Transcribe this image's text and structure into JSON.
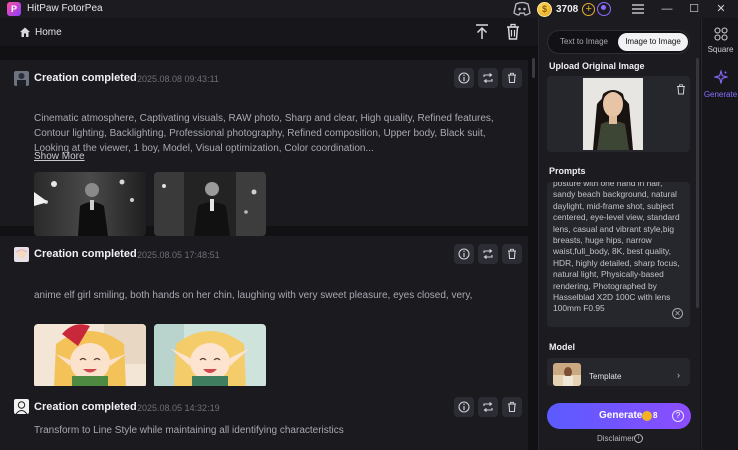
{
  "app": {
    "title": "HitPaw FotorPea",
    "logo_letter": "P"
  },
  "titlebar": {
    "coin_symbol": "$",
    "coins": "3708",
    "plus": "+"
  },
  "window": {
    "minimize": "—",
    "maximize": "☐",
    "close": "✕"
  },
  "header": {
    "home_label": "Home"
  },
  "cards": [
    {
      "title": "Creation completed",
      "date": "2025.08.08   09:43:11",
      "prompt": "Cinematic atmosphere, Captivating visuals, RAW photo, Sharp and clear, High quality, Refined features, Contour lighting, Backlighting, Professional photography, Refined composition, Upper body, Black suit, Looking at the viewer, 1 boy, Model, Visual optimization, Color coordination...",
      "show_more": "Show More"
    },
    {
      "title": "Creation completed",
      "date": "2025.08.05   17:48:51",
      "prompt": "anime elf girl smiling, both hands on her chin, laughing with very sweet pleasure, eyes closed, very,"
    },
    {
      "title": "Creation completed",
      "date": "2025.08.05   14:32:19",
      "prompt": "Transform to Line Style while maintaining all identifying characteristics"
    }
  ],
  "panel": {
    "tab_text_to_image": "Text to Image",
    "tab_image_to_image": "Image to Image",
    "upload_label": "Upload Original Image",
    "prompts_label": "Prompts",
    "prompt_text": "posture with one hand in hair, sandy beach background, natural daylight, mid-frame shot, subject centered, eye-level view, standard lens, casual and vibrant style,big breasts, huge hips, narrow waist,full_body, 8K, best quality, HDR, highly detailed, sharp focus, natural light, Physically-based rendering, Photographed by Hasselblad X2D 100C with lens 100mm F0.95",
    "model_label": "Model",
    "model_name": "Template",
    "generate_label": "Generate",
    "generate_cost": "8",
    "disclaimer": "Disclaimer",
    "info_glyph": "i",
    "help_glyph": "?",
    "clear_glyph": "✕",
    "chevron_glyph": "›"
  },
  "nav": {
    "square": "Square",
    "generate": "Generate"
  },
  "colors": {
    "accent": "#7b5cff",
    "background": "#141418",
    "card": "#1a1a1f"
  }
}
